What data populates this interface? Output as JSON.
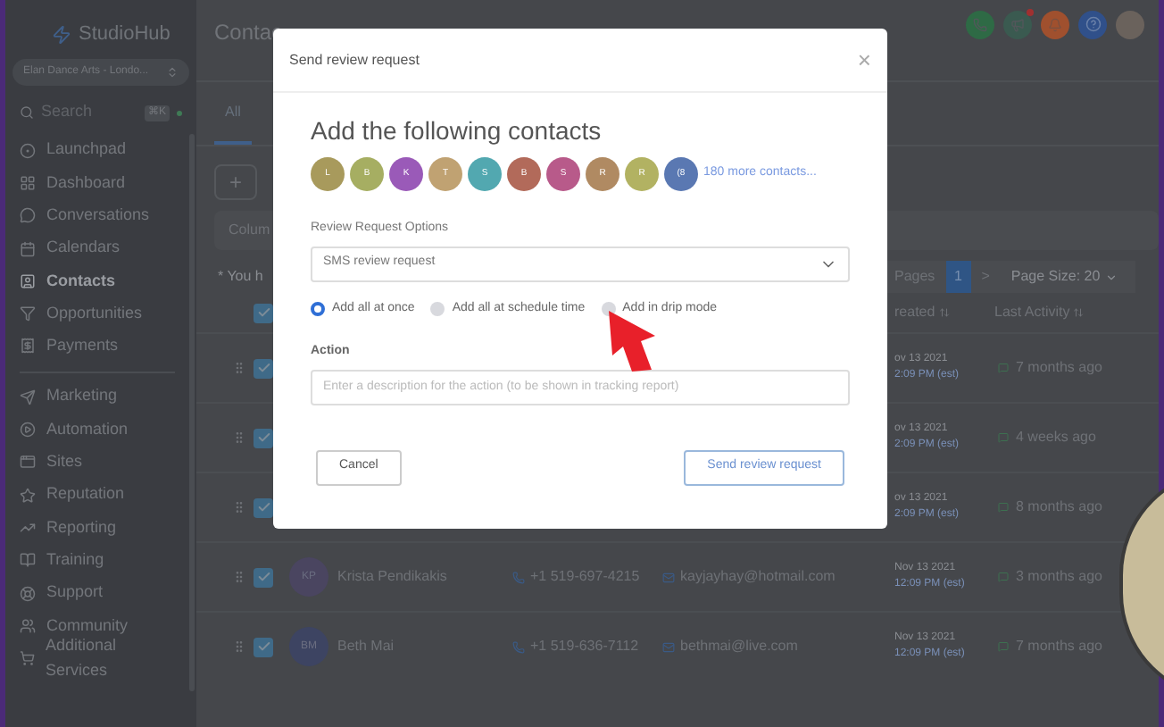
{
  "sidebar": {
    "logo": "StudioHub",
    "account": "Elan Dance Arts - Londo...",
    "search": {
      "placeholder": "Search",
      "shortcut": "⌘K"
    },
    "nav_groups": [
      [
        {
          "label": "Launchpad",
          "selected": false
        },
        {
          "label": "Dashboard",
          "selected": false
        },
        {
          "label": "Conversations",
          "selected": false
        },
        {
          "label": "Calendars",
          "selected": false
        },
        {
          "label": "Contacts",
          "selected": true
        },
        {
          "label": "Opportunities",
          "selected": false
        },
        {
          "label": "Payments",
          "selected": false
        }
      ],
      [
        {
          "label": "Marketing",
          "selected": false
        },
        {
          "label": "Automation",
          "selected": false
        },
        {
          "label": "Sites",
          "selected": false
        },
        {
          "label": "Reputation",
          "selected": false
        },
        {
          "label": "Reporting",
          "selected": false
        },
        {
          "label": "Training",
          "selected": false
        },
        {
          "label": "Support",
          "selected": false
        },
        {
          "label": "Community",
          "selected": false
        },
        {
          "label": "Additional Services",
          "selected": false
        }
      ]
    ]
  },
  "header": {
    "title": "Contac"
  },
  "tabs": [
    {
      "label": "All",
      "selected": true
    }
  ],
  "toolbar": {
    "add": "+",
    "columns": "Colum",
    "notice": "* You h"
  },
  "pagination": {
    "label": "Pages",
    "pages": [
      {
        "label": "1",
        "selected": true
      }
    ],
    "next": ">",
    "page_size": "Page Size: 20"
  },
  "table": {
    "header_checked": true,
    "columns": [
      "reated",
      "Last Activity"
    ],
    "rows": [
      {
        "checked": true,
        "date": "ov 13 2021",
        "time": "2:09 PM (est)",
        "last_activity": "7 months ago"
      },
      {
        "checked": true,
        "date": "ov 13 2021",
        "time": "2:09 PM (est)",
        "last_activity": "4 weeks ago"
      },
      {
        "checked": true,
        "date": "ov 13 2021",
        "time": "2:09 PM (est)",
        "last_activity": "8 months ago"
      },
      {
        "checked": true,
        "initials": "KP",
        "color": "#4a4560",
        "name": "Krista Pendikakis",
        "phone": "+1 519-697-4215",
        "email": "kayjayhay@hotmail.com",
        "date": "Nov 13 2021",
        "time": "12:09 PM (est)",
        "last_activity": "3 months ago"
      },
      {
        "checked": true,
        "initials": "BM",
        "color": "#3d4462",
        "name": "Beth Mai",
        "phone": "+1 519-636-7112",
        "email": "bethmai@live.com",
        "date": "Nov 13 2021",
        "time": "12:09 PM (est)",
        "last_activity": "7 months ago"
      }
    ]
  },
  "modal": {
    "title": "Send review request",
    "close": "×",
    "heading": "Add the following contacts",
    "contacts": [
      {
        "initial": "L",
        "color": "#a89a5c"
      },
      {
        "initial": "B",
        "color": "#a6ae62"
      },
      {
        "initial": "K",
        "color": "#9a5ab8"
      },
      {
        "initial": "T",
        "color": "#c0a272"
      },
      {
        "initial": "S",
        "color": "#52a8b0"
      },
      {
        "initial": "B",
        "color": "#b26a5a"
      },
      {
        "initial": "S",
        "color": "#b85a8a"
      },
      {
        "initial": "R",
        "color": "#b08a62"
      },
      {
        "initial": "R",
        "color": "#b2b262"
      },
      {
        "initial": "(8",
        "color": "#5a78b2"
      }
    ],
    "more": "180 more contacts...",
    "options_label": "Review Request Options",
    "select_value": "SMS review request",
    "modes": [
      {
        "label": "Add all at once",
        "selected": true
      },
      {
        "label": "Add all at schedule time",
        "selected": false
      },
      {
        "label": "Add in drip mode",
        "selected": false
      }
    ],
    "action_label": "Action",
    "action_placeholder": "Enter a description for the action (to be shown in tracking report)",
    "buttons": [
      "Cancel",
      "Send review request"
    ]
  }
}
